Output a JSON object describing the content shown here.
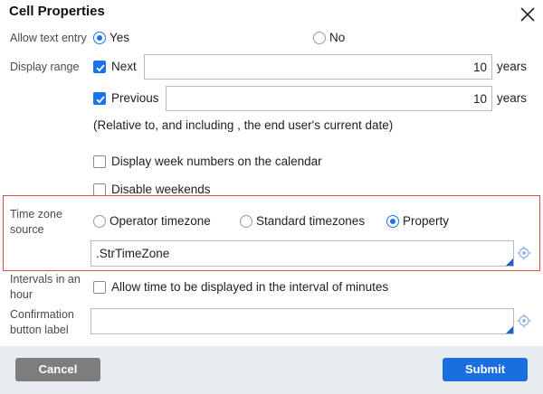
{
  "dialog": {
    "title": "Cell Properties"
  },
  "allow_text_entry": {
    "label": "Allow text entry",
    "yes": "Yes",
    "no": "No",
    "selected": "Yes"
  },
  "display_range": {
    "label": "Display range",
    "next": {
      "label": "Next",
      "value": "10",
      "unit": "years",
      "checked": true
    },
    "previous": {
      "label": "Previous",
      "value": "10",
      "unit": "years",
      "checked": true
    },
    "note": "(Relative to, and including , the end user's current date)"
  },
  "options": {
    "week_numbers": "Display week numbers on the calendar",
    "disable_weekends": "Disable weekends"
  },
  "time_zone": {
    "label_line1": "Time zone",
    "label_line2": "source",
    "operator": "Operator timezone",
    "standard": "Standard timezones",
    "property": "Property",
    "selected": "Property",
    "value": ".StrTimeZone"
  },
  "intervals": {
    "label_line1": "Intervals in an",
    "label_line2": "hour",
    "option": "Allow time to be displayed in the interval of minutes"
  },
  "confirmation": {
    "label_line1": "Confirmation",
    "label_line2": "button label",
    "value": ""
  },
  "footer": {
    "cancel": "Cancel",
    "submit": "Submit"
  },
  "colors": {
    "accent": "#1a73e8",
    "highlight": "#e0484a",
    "footer_bg": "#e9ecef",
    "cancel_bg": "#7d7d7d"
  }
}
